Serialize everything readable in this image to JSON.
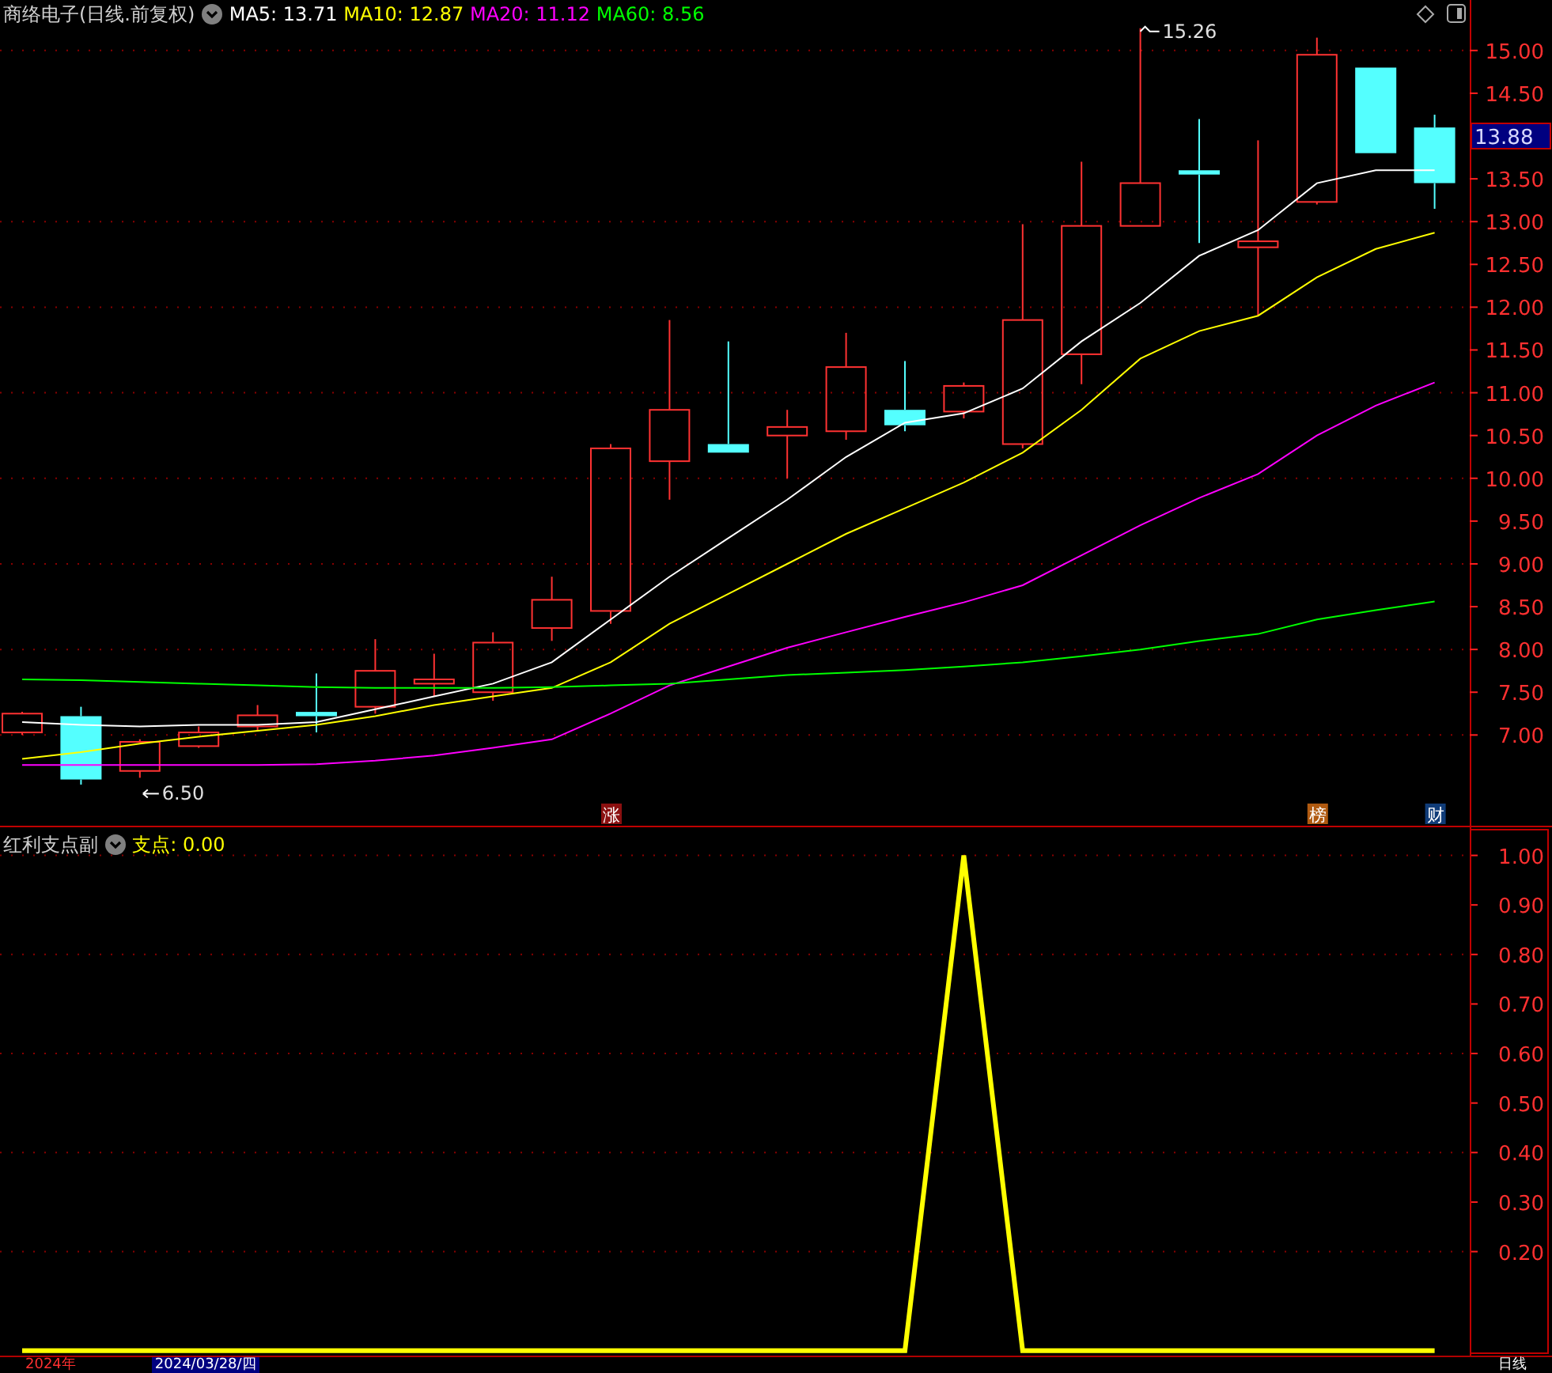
{
  "header": {
    "title": "商络电子(日线.前复权)",
    "indicators": [
      {
        "label": "MA5: 13.71",
        "color": "#ffffff"
      },
      {
        "label": "MA10: 12.87",
        "color": "#ffff00"
      },
      {
        "label": "MA20: 11.12",
        "color": "#ff00ff"
      },
      {
        "label": "MA60: 8.56",
        "color": "#00ff00"
      }
    ]
  },
  "price_chart": {
    "current_price": "13.88",
    "markers": [
      {
        "kind": "high",
        "text": "15.26"
      },
      {
        "kind": "low",
        "text": "6.50"
      }
    ],
    "badges": [
      {
        "text": "涨",
        "color": "#8b1010"
      },
      {
        "text": "榜",
        "color": "#b05a10"
      },
      {
        "text": "财",
        "color": "#103c78"
      }
    ],
    "chart_data": {
      "type": "line",
      "grid": true,
      "categories": [
        null,
        null,
        null,
        null,
        null,
        null,
        null,
        null,
        null,
        null,
        null,
        null,
        null,
        null,
        null,
        null,
        null,
        null,
        null,
        null,
        null,
        null,
        null,
        null,
        null
      ],
      "ylim": [
        5.94,
        15.59
      ],
      "yticks": [
        {
          "value": 7,
          "label": "7.00"
        },
        {
          "value": 7.5,
          "label": "7.50"
        },
        {
          "value": 8,
          "label": "8.00"
        },
        {
          "value": 8.5,
          "label": "8.50"
        },
        {
          "value": 9,
          "label": "9.00"
        },
        {
          "value": 9.5,
          "label": "9.50"
        },
        {
          "value": 10,
          "label": "10.00"
        },
        {
          "value": 10.5,
          "label": "10.50"
        },
        {
          "value": 11,
          "label": "11.00"
        },
        {
          "value": 11.5,
          "label": "11.50"
        },
        {
          "value": 12,
          "label": "12.00"
        },
        {
          "value": 12.5,
          "label": "12.50"
        },
        {
          "value": 13,
          "label": "13.00"
        },
        {
          "value": 13.5,
          "label": "13.50"
        },
        {
          "value": 14.5,
          "label": "14.50"
        },
        {
          "value": 15,
          "label": "15.00"
        }
      ],
      "series": [
        {
          "color": "#ffffff",
          "values": [
            7.15,
            7.12,
            7.1,
            7.12,
            7.12,
            7.15,
            7.3,
            7.45,
            7.6,
            7.85,
            8.35,
            8.85,
            9.3,
            9.75,
            10.25,
            10.65,
            10.76,
            11.05,
            11.6,
            12.05,
            12.6,
            12.9,
            13.45,
            13.6,
            13.6
          ]
        },
        {
          "color": "#ffff00",
          "values": [
            6.72,
            6.8,
            6.9,
            6.98,
            7.05,
            7.12,
            7.22,
            7.35,
            7.45,
            7.55,
            7.85,
            8.3,
            8.65,
            9.0,
            9.35,
            9.65,
            9.95,
            10.3,
            10.8,
            11.4,
            11.72,
            11.9,
            12.35,
            12.68,
            12.87
          ]
        },
        {
          "color": "#ff00ff",
          "values": [
            6.65,
            6.65,
            6.65,
            6.65,
            6.65,
            6.66,
            6.7,
            6.76,
            6.85,
            6.95,
            7.25,
            7.58,
            7.8,
            8.02,
            8.2,
            8.38,
            8.55,
            8.75,
            9.1,
            9.45,
            9.77,
            10.05,
            10.5,
            10.85,
            11.12
          ]
        },
        {
          "color": "#00ff00",
          "values": [
            7.65,
            7.64,
            7.62,
            7.6,
            7.58,
            7.56,
            7.55,
            7.55,
            7.55,
            7.56,
            7.58,
            7.6,
            7.65,
            7.7,
            7.73,
            7.76,
            7.8,
            7.85,
            7.92,
            8.0,
            8.1,
            8.18,
            8.35,
            8.46,
            8.56
          ]
        }
      ]
    }
  },
  "lower_header": {
    "title": "红利支点副",
    "indicators": [
      {
        "label": "支点: 0.00",
        "color": "#ffff00"
      }
    ]
  },
  "indicator_chart": {
    "chart_data": {
      "type": "line",
      "grid": true,
      "categories": [
        null,
        null,
        null,
        null,
        null,
        null,
        null,
        null,
        null,
        null,
        null,
        null,
        null,
        null,
        null,
        null,
        null,
        null,
        null,
        null,
        null,
        null,
        null,
        null,
        null
      ],
      "ylim": [
        -0.01,
        1.06
      ],
      "yticks": [
        {
          "value": 0.2,
          "label": "0.20"
        },
        {
          "value": 0.3,
          "label": "0.30"
        },
        {
          "value": 0.4,
          "label": "0.40"
        },
        {
          "value": 0.5,
          "label": "0.50"
        },
        {
          "value": 0.6,
          "label": "0.60"
        },
        {
          "value": 0.7,
          "label": "0.70"
        },
        {
          "value": 0.8,
          "label": "0.80"
        },
        {
          "value": 0.9,
          "label": "0.90"
        },
        {
          "value": 1.0,
          "label": "1.00"
        }
      ],
      "series": [
        {
          "color": "#ffff00",
          "values": [
            0,
            0,
            0,
            0,
            0,
            0,
            0,
            0,
            0,
            0,
            0,
            0,
            0,
            0,
            0,
            0,
            1,
            0,
            0,
            0,
            0,
            0,
            0,
            0,
            0
          ]
        }
      ]
    }
  },
  "footer": {
    "start_label": "2024年",
    "cursor_date": "2024/03/28/四",
    "period": "日线"
  }
}
